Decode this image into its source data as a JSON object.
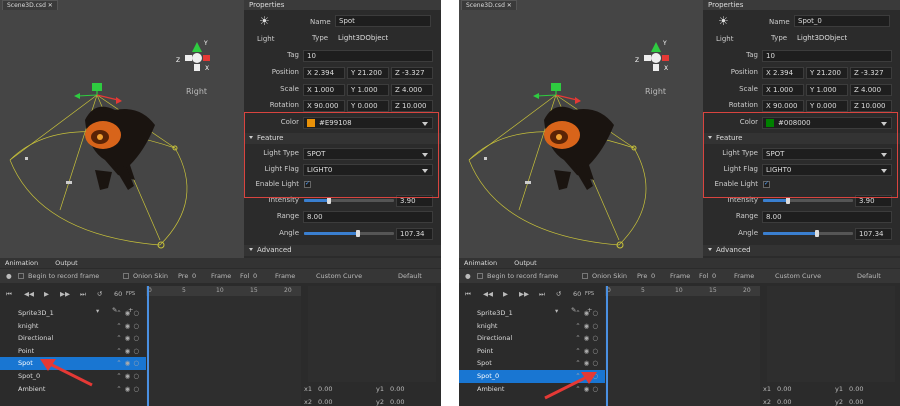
{
  "panels": [
    {
      "tab": "Scene3D.csd",
      "view_label": "Right",
      "properties": {
        "title": "Properties",
        "light_icon_label": "Light",
        "name_label": "Name",
        "name_value": "Spot",
        "type_label": "Type",
        "type_value": "Light3DObject",
        "tag_label": "Tag",
        "tag_value": "10",
        "position_label": "Position",
        "pos_x": "X 2.394",
        "pos_y": "Y 21.200",
        "pos_z": "Z -3.327",
        "scale_label": "Scale",
        "scale_x": "X 1.000",
        "scale_y": "Y 1.000",
        "scale_z": "Z 4.000",
        "rotation_label": "Rotation",
        "rot_x": "X 90.000",
        "rot_y": "Y 0.000",
        "rot_z": "Z 10.000",
        "color_label": "Color",
        "color_value": "#E99108",
        "color_hex": "#E99108",
        "feature_label": "Feature",
        "light_type_label": "Light Type",
        "light_type_value": "SPOT",
        "light_flag_label": "Light Flag",
        "light_flag_value": "LIGHT0",
        "enable_light_label": "Enable Light",
        "intensity_label": "Intensity",
        "intensity_value": "3.90",
        "intensity_fraction": 0.28,
        "range_label": "Range",
        "range_value": "8.00",
        "angle_label": "Angle",
        "angle_value": "107.34",
        "angle_fraction": 0.6,
        "advanced_label": "Advanced"
      },
      "animation": {
        "tab_animation": "Animation",
        "tab_output": "Output",
        "record_label": "Begin to record frame",
        "onion_label": "Onion Skin",
        "pre_label": "Pre",
        "pre_value": "0",
        "frame_label": "Frame",
        "fol_label": "Fol",
        "fol_value": "0",
        "frame_dd_label": "Frame",
        "custom_curve_label": "Custom Curve",
        "default_label": "Default",
        "fps_value": "60",
        "fps_label": "FPS",
        "ticks": [
          "0",
          "5",
          "10",
          "15",
          "20"
        ],
        "layers": [
          "Sprite3D_1",
          "knight",
          "Directional",
          "Point",
          "Spot",
          "Spot_0",
          "Ambient"
        ],
        "selected_layer": "Spot",
        "x1_label": "x1",
        "x1_value": "0.00",
        "y1_label": "y1",
        "y1_value": "0.00",
        "x2_label": "x2",
        "x2_value": "0.00",
        "y2_label": "y2",
        "y2_value": "0.00"
      }
    },
    {
      "tab": "Scene3D.csd",
      "view_label": "Right",
      "properties": {
        "title": "Properties",
        "light_icon_label": "Light",
        "name_label": "Name",
        "name_value": "Spot_0",
        "type_label": "Type",
        "type_value": "Light3DObject",
        "tag_label": "Tag",
        "tag_value": "10",
        "position_label": "Position",
        "pos_x": "X 2.394",
        "pos_y": "Y 21.200",
        "pos_z": "Z -3.327",
        "scale_label": "Scale",
        "scale_x": "X 1.000",
        "scale_y": "Y 1.000",
        "scale_z": "Z 4.000",
        "rotation_label": "Rotation",
        "rot_x": "X 90.000",
        "rot_y": "Y 0.000",
        "rot_z": "Z 10.000",
        "color_label": "Color",
        "color_value": "#008000",
        "color_hex": "#008000",
        "feature_label": "Feature",
        "light_type_label": "Light Type",
        "light_type_value": "SPOT",
        "light_flag_label": "Light Flag",
        "light_flag_value": "LIGHT0",
        "enable_light_label": "Enable Light",
        "intensity_label": "Intensity",
        "intensity_value": "3.90",
        "intensity_fraction": 0.28,
        "range_label": "Range",
        "range_value": "8.00",
        "angle_label": "Angle",
        "angle_value": "107.34",
        "angle_fraction": 0.6,
        "advanced_label": "Advanced"
      },
      "animation": {
        "tab_animation": "Animation",
        "tab_output": "Output",
        "record_label": "Begin to record frame",
        "onion_label": "Onion Skin",
        "pre_label": "Pre",
        "pre_value": "0",
        "frame_label": "Frame",
        "fol_label": "Fol",
        "fol_value": "0",
        "frame_dd_label": "Frame",
        "custom_curve_label": "Custom Curve",
        "default_label": "Default",
        "fps_value": "60",
        "fps_label": "FPS",
        "ticks": [
          "0",
          "5",
          "10",
          "15",
          "20"
        ],
        "layers": [
          "Sprite3D_1",
          "knight",
          "Directional",
          "Point",
          "Spot",
          "Spot_0",
          "Ambient"
        ],
        "selected_layer": "Spot_0",
        "x1_label": "x1",
        "x1_value": "0.00",
        "y1_label": "y1",
        "y1_value": "0.00",
        "x2_label": "x2",
        "x2_value": "0.00",
        "y2_label": "y2",
        "y2_value": "0.00"
      }
    }
  ],
  "colors": {
    "highlight_box": "#d9443f",
    "selection": "#1976d2",
    "arrow": "#e53935"
  }
}
